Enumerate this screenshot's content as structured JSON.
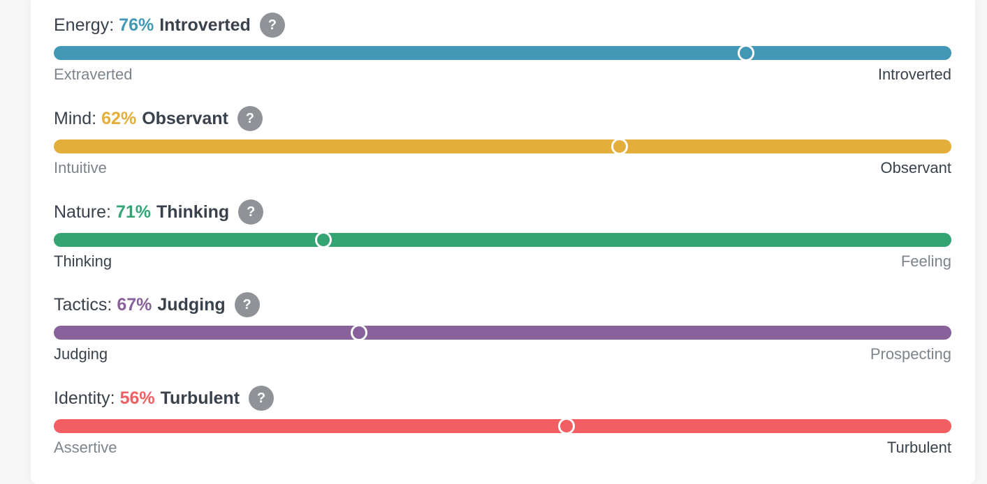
{
  "traits": [
    {
      "category": "Energy:",
      "percent": "76%",
      "side": "Introverted",
      "help": "?",
      "left_label": "Extraverted",
      "right_label": "Introverted",
      "color": "#4298b4",
      "knob_position": 0.771,
      "chosen_side": "right"
    },
    {
      "category": "Mind:",
      "percent": "62%",
      "side": "Observant",
      "help": "?",
      "left_label": "Intuitive",
      "right_label": "Observant",
      "color": "#e4ae3a",
      "knob_position": 0.63,
      "chosen_side": "right"
    },
    {
      "category": "Nature:",
      "percent": "71%",
      "side": "Thinking",
      "help": "?",
      "left_label": "Thinking",
      "right_label": "Feeling",
      "color": "#33a474",
      "knob_position": 0.3,
      "chosen_side": "left"
    },
    {
      "category": "Tactics:",
      "percent": "67%",
      "side": "Judging",
      "help": "?",
      "left_label": "Judging",
      "right_label": "Prospecting",
      "color": "#88619a",
      "knob_position": 0.34,
      "chosen_side": "left"
    },
    {
      "category": "Identity:",
      "percent": "56%",
      "side": "Turbulent",
      "help": "?",
      "left_label": "Assertive",
      "right_label": "Turbulent",
      "color": "#f25e62",
      "knob_position": 0.571,
      "chosen_side": "right"
    }
  ]
}
